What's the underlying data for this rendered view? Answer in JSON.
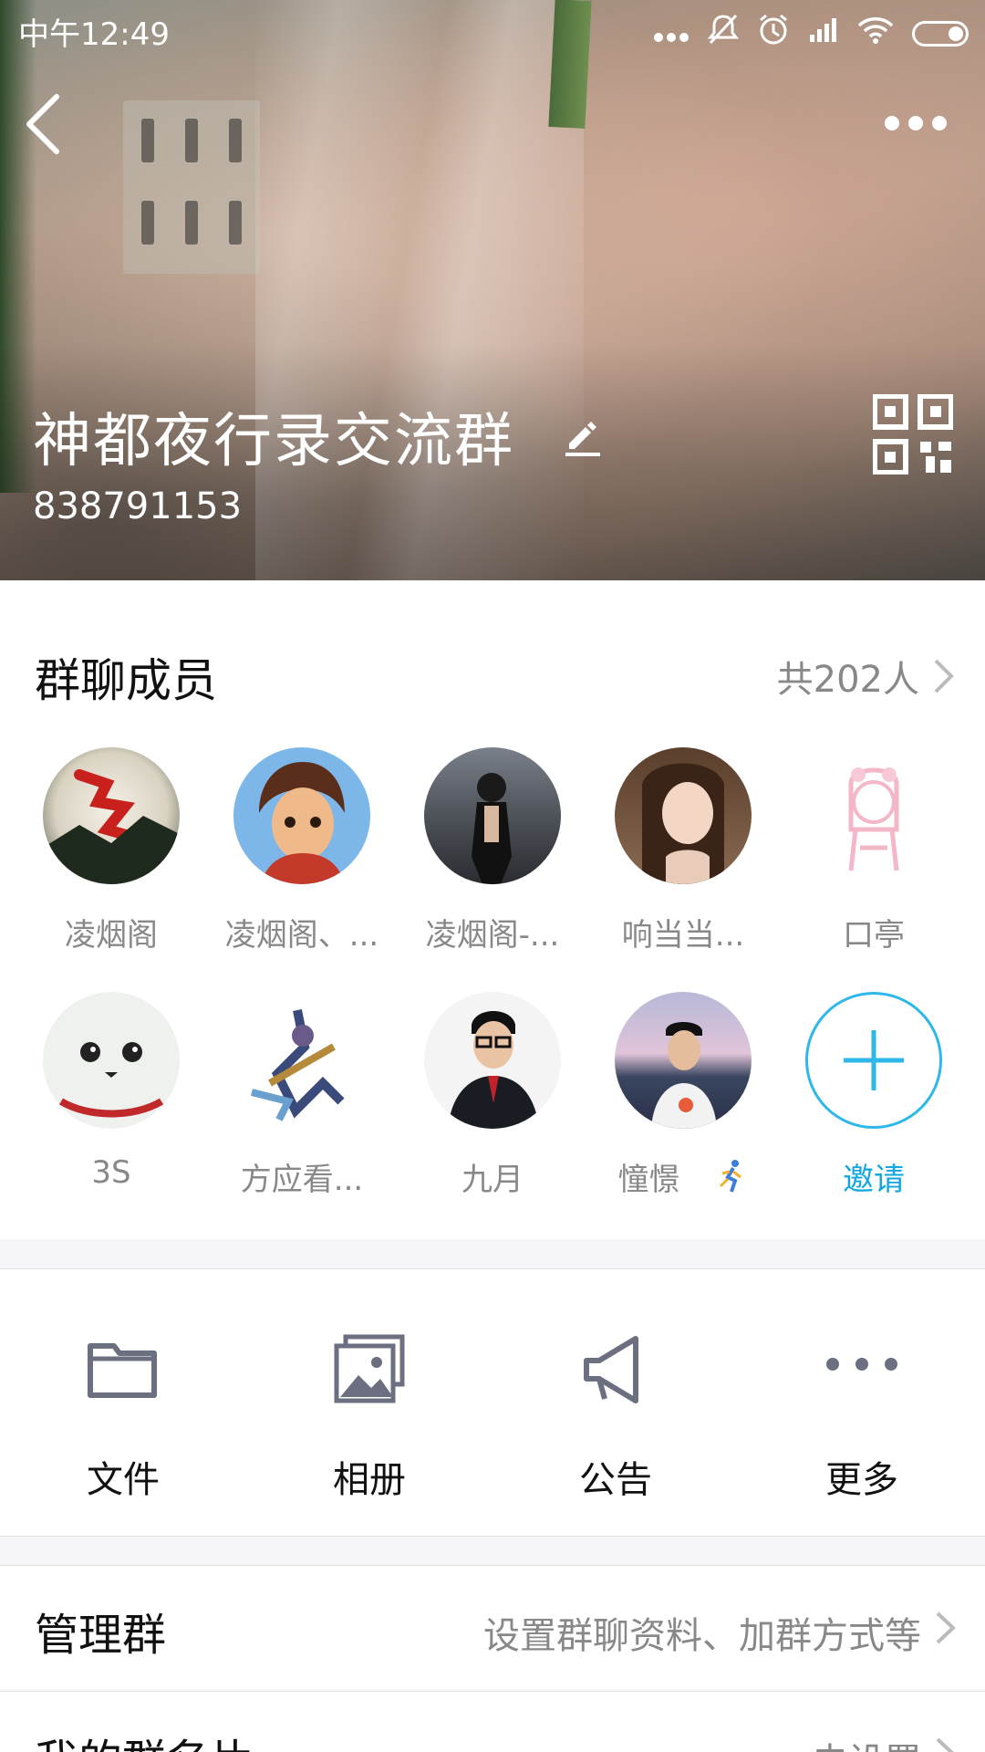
{
  "status_bar": {
    "time": "中午12:49"
  },
  "header": {
    "group_name": "神都夜行录交流群",
    "group_id": "838791153"
  },
  "members_section": {
    "title": "群聊成员",
    "count": "共202人",
    "members": [
      {
        "name": "凌烟阁"
      },
      {
        "name": "凌烟阁、..."
      },
      {
        "name": "凌烟阁-..."
      },
      {
        "name": "响当当..."
      },
      {
        "name": "口亭"
      },
      {
        "name": "3S"
      },
      {
        "name": "方应看..."
      },
      {
        "name": "九月"
      },
      {
        "name": "憧憬"
      },
      {
        "name": "邀请"
      }
    ]
  },
  "tools": {
    "files": "文件",
    "album": "相册",
    "notice": "公告",
    "more": "更多"
  },
  "rows": {
    "manage": {
      "title": "管理群",
      "value": "设置群聊资料、加群方式等"
    },
    "card": {
      "title": "我的群名片",
      "value": "未设置"
    }
  },
  "colors": {
    "accent": "#12a6e0",
    "muted": "#888888"
  }
}
